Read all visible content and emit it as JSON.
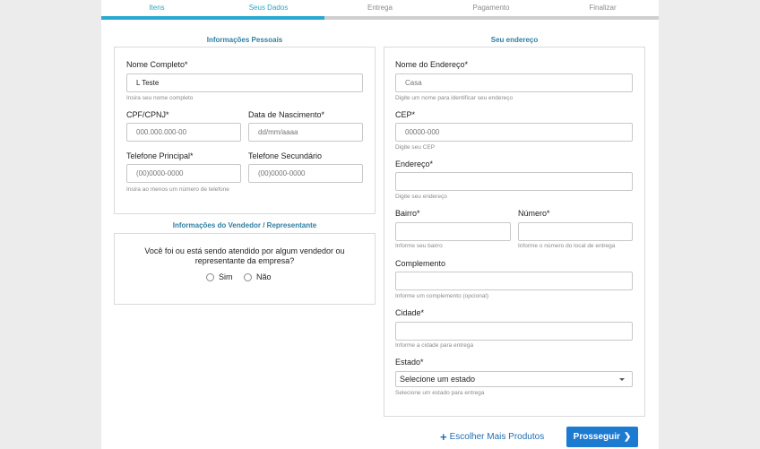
{
  "steps": [
    {
      "label": "Itens",
      "done": true
    },
    {
      "label": "Seus Dados",
      "done": true
    },
    {
      "label": "Entrega",
      "done": false
    },
    {
      "label": "Pagamento",
      "done": false
    },
    {
      "label": "Finalizar",
      "done": false
    }
  ],
  "personal": {
    "title": "Informações Pessoais",
    "full_name_label": "Nome Completo*",
    "full_name_value": "L Teste",
    "full_name_help": "Insira seu nome completo",
    "cpf_label": "CPF/CPNJ*",
    "cpf_placeholder": "000.000.000-00",
    "birth_label": "Data de Nascimento*",
    "birth_placeholder": "dd/mm/aaaa",
    "phone_label": "Telefone Principal*",
    "phone_placeholder": "(00)0000-0000",
    "phone2_label": "Telefone Secundário",
    "phone2_placeholder": "(00)0000-0000",
    "phone_help": "Insira ao menos um número de telefone"
  },
  "seller": {
    "title": "Informações do Vendedor / Representante",
    "question_line1": "Você foi ou está sendo atendido por algum vendedor ou",
    "question_line2": "representante da empresa?",
    "yes_label": "Sim",
    "no_label": "Não"
  },
  "address": {
    "title": "Seu endereço",
    "name_label": "Nome do Endereço*",
    "name_placeholder": "Casa",
    "name_help": "Digite um nome para identificar seu endereço",
    "cep_label": "CEP*",
    "cep_placeholder": "00000-000",
    "cep_help": "Digite seu CEP",
    "street_label": "Endereço*",
    "street_help": "Digite seu endereço",
    "district_label": "Bairro*",
    "district_help": "Informe seu bairro",
    "number_label": "Número*",
    "number_help": "Informe o número do local de entrega",
    "complement_label": "Complemento",
    "complement_help": "Informe um complemento (opcional)",
    "city_label": "Cidade*",
    "city_help": "Informe a cidade para entrega",
    "state_label": "Estado*",
    "state_selected": "Selecione um estado",
    "state_help": "Selecione um estado para entrega"
  },
  "actions": {
    "more_products": "Escolher Mais Produtos",
    "proceed": "Prosseguir"
  },
  "colors": {
    "accent": "#29a9cf",
    "primary_button": "#1c7ad1",
    "link": "#1f6fb3"
  }
}
